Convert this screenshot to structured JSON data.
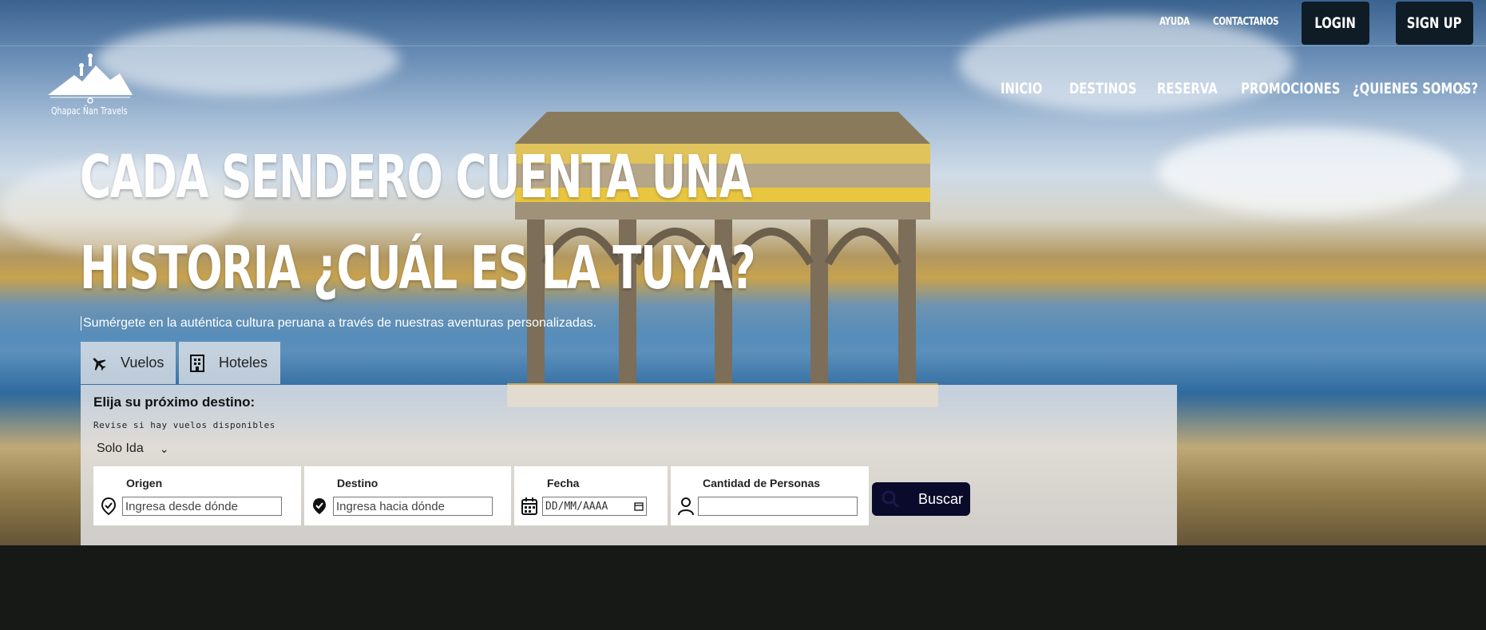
{
  "brand": {
    "name": "Qhapac Ñan Travels"
  },
  "utility_nav": {
    "help": "AYUDA",
    "contact": "CONTACTANOS",
    "login": "LOGIN",
    "signup": "SIGN UP"
  },
  "main_nav": {
    "items": [
      "INICIO",
      "DESTINOS",
      "RESERVA",
      "PROMOCIONES",
      "¿QUIENES SOMOS?"
    ]
  },
  "hero": {
    "headline_line1": "CADA SENDERO CUENTA UNA",
    "headline_line2": "HISTORIA ¿CUÁL ES LA TUYA?",
    "subtitle": "Sumérgete en la auténtica cultura peruana a través de nuestras aventuras personalizadas."
  },
  "booking": {
    "tabs": [
      {
        "label": "Vuelos",
        "icon": "airplane-icon"
      },
      {
        "label": "Hoteles",
        "icon": "building-icon"
      }
    ],
    "title": "Elija su próximo destino:",
    "subtitle": "Revise si hay vuelos disponibles",
    "trip_type": "Solo Ida",
    "fields": {
      "origin": {
        "label": "Origen",
        "placeholder": "Ingresa desde dónde",
        "icon": "location-outline-icon"
      },
      "destination": {
        "label": "Destino",
        "placeholder": "Ingresa hacia dónde",
        "icon": "location-filled-icon"
      },
      "date": {
        "label": "Fecha",
        "placeholder": "DD/MM/AAAA",
        "icon": "calendar-icon"
      },
      "people": {
        "label": "Cantidad de Personas",
        "value": "",
        "icon": "person-icon"
      }
    },
    "search_label": "Buscar"
  },
  "colors": {
    "accent_dark": "#0a0a2a",
    "header_button": "#0f1c26",
    "footer": "#161916"
  }
}
